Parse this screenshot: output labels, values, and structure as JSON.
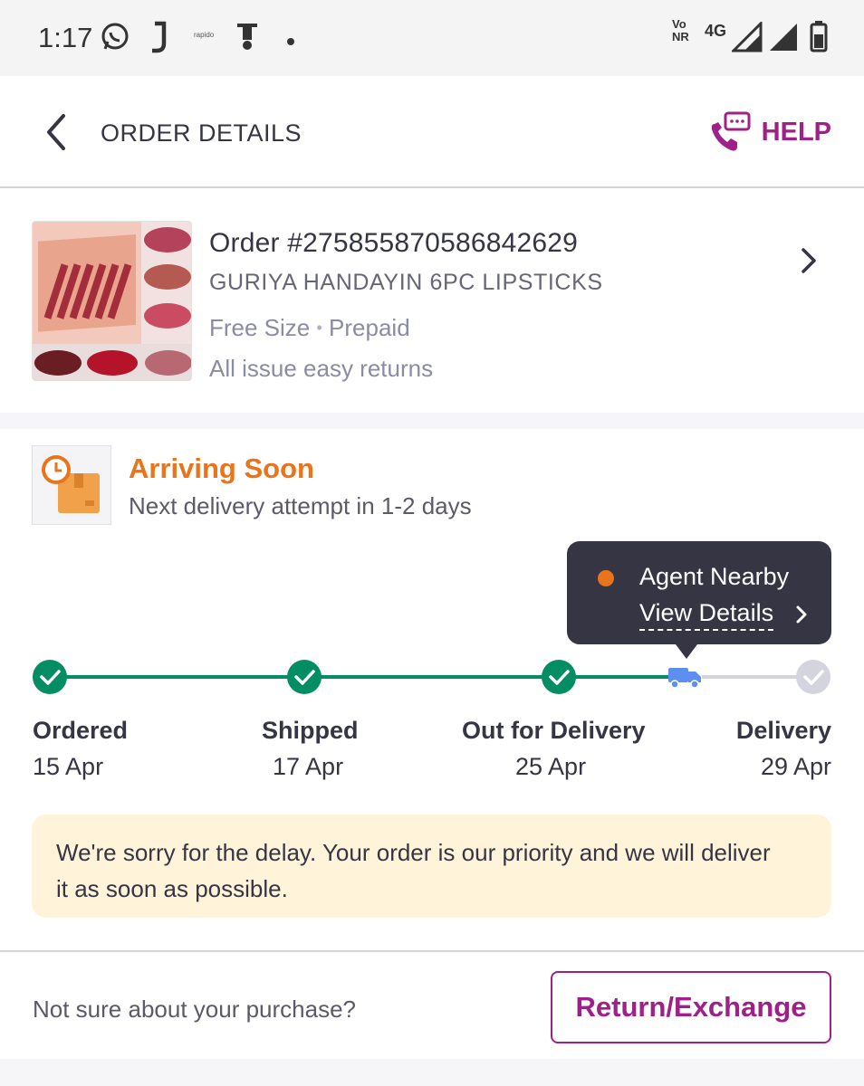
{
  "statusbar": {
    "time": "1:17",
    "icons": [
      "whatsapp-icon",
      "j-app-icon",
      "rapido-icon",
      "scooter-icon",
      "notification-dot-icon"
    ],
    "rapido_text": "rapido",
    "network": {
      "volte_top": "Vo",
      "volte_bottom": "NR",
      "type": "4G"
    },
    "right_icons": [
      "signal-icon",
      "signal-icon",
      "battery-icon"
    ]
  },
  "header": {
    "title": "ORDER DETAILS",
    "help_label": "HELP"
  },
  "product": {
    "order_number": "Order #275855870586842629",
    "name": "GURIYA HANDAYIN 6PC LIPSTICKS",
    "size": "Free Size",
    "separator": "•",
    "payment": "Prepaid",
    "returns": "All issue easy returns"
  },
  "status": {
    "headline": "Arriving Soon",
    "subline": "Next delivery attempt in 1-2 days",
    "tooltip": {
      "title": "Agent Nearby",
      "link": "View Details"
    },
    "steps": [
      {
        "label": "Ordered",
        "date": "15 Apr",
        "state": "done"
      },
      {
        "label": "Shipped",
        "date": "17 Apr",
        "state": "done"
      },
      {
        "label": "Out for Delivery",
        "date": "25 Apr",
        "state": "done"
      },
      {
        "label": "Delivery",
        "date": "29 Apr",
        "state": "pending"
      }
    ],
    "delay_message": "We're sorry for the delay. Your order is our priority and we will deliver it as soon as possible."
  },
  "bottom": {
    "prompt": "Not sure about your purchase?",
    "button": "Return/Exchange"
  },
  "colors": {
    "brand": "#9f2089",
    "success": "#038d63",
    "warning": "#e8741c",
    "delay_bg": "#fff4d9",
    "tooltip_bg": "#353543",
    "truck": "#5c8ff0",
    "pending": "#d4d4de"
  }
}
